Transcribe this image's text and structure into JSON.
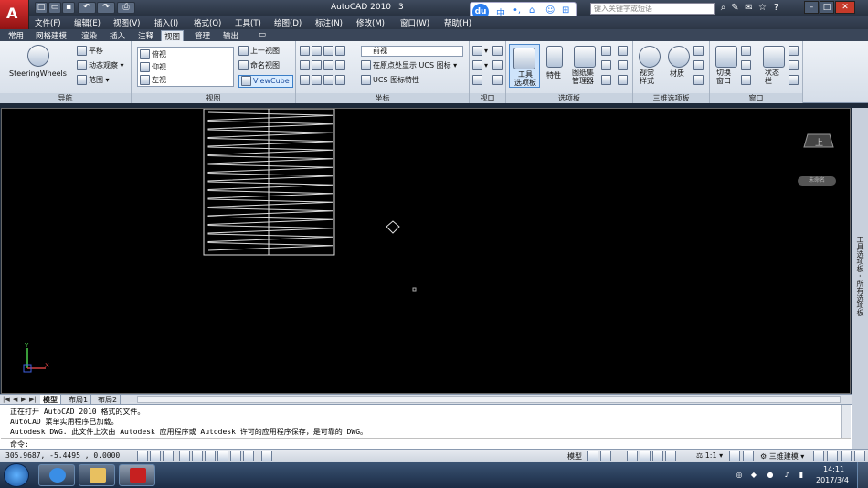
{
  "window": {
    "title": "AutoCAD 2010",
    "title_extra": "3",
    "search_placeholder": "键入关键字或短语"
  },
  "ime": {
    "logo": "du",
    "mode": "中",
    "punct": "•,"
  },
  "menu": [
    "文件(F)",
    "编辑(E)",
    "视图(V)",
    "插入(I)",
    "格式(O)",
    "工具(T)",
    "绘图(D)",
    "标注(N)",
    "修改(M)",
    "窗口(W)",
    "帮助(H)"
  ],
  "ribbon_tabs": [
    "常用",
    "网格建模",
    "渲染",
    "插入",
    "注释",
    "视图",
    "管理",
    "输出",
    "▭"
  ],
  "active_tab": "视图",
  "ribbon": {
    "nav": {
      "title": "导航",
      "steering": "SteeringWheels",
      "pan": "平移",
      "orbit": "动态观察",
      "extents": "范围"
    },
    "views": {
      "title": "视图",
      "list": [
        "俯视",
        "仰视",
        "左视"
      ],
      "prev_view": "上一视图",
      "named_views": "命名视图",
      "viewcube": "ViewCube"
    },
    "coords": {
      "title": "坐标",
      "ucs_current": "前视",
      "ucs_origin": "在原点处显示 UCS 图标",
      "ucs_props": "UCS 图标特性"
    },
    "viewports": {
      "title": "视口"
    },
    "palettes": {
      "title": "选项板",
      "tool_palette": "工具\n选项板",
      "properties": "特性",
      "sheetset": "图纸集\n管理器"
    },
    "palettes3d": {
      "title": "三维选项板",
      "visual_styles": "视觉\n样式",
      "materials": "材质"
    },
    "windows": {
      "title": "窗口",
      "switch": "切换\n窗口",
      "status": "状态\n栏"
    }
  },
  "drawing": {
    "viewcube_face": "上",
    "viewcube_label": "未命名",
    "axis_x": "X",
    "axis_y": "Y",
    "palette_strip": "工具选项板 - 所有选项板"
  },
  "layout_tabs": [
    "模型",
    "布局1",
    "布局2"
  ],
  "active_layout": "模型",
  "command": {
    "lines": [
      "正在打开 AutoCAD 2010 格式的文件。",
      "AutoCAD 菜单实用程序已加载。",
      "Autodesk DWG.  此文件上次由 Autodesk 应用程序或 Autodesk 许可的应用程序保存，是可靠的 DWG。"
    ],
    "prompt": "命令:"
  },
  "status": {
    "coords": "305.9687, -5.4495 , 0.0000",
    "model": "模型",
    "scale": "1:1",
    "workspace": "三维建模"
  },
  "taskbar": {
    "time": "14:11",
    "date": "2017/3/4"
  },
  "colors": {
    "accent": "#3c7fc7",
    "autocad_red": "#c62020",
    "canvas": "#000000"
  }
}
